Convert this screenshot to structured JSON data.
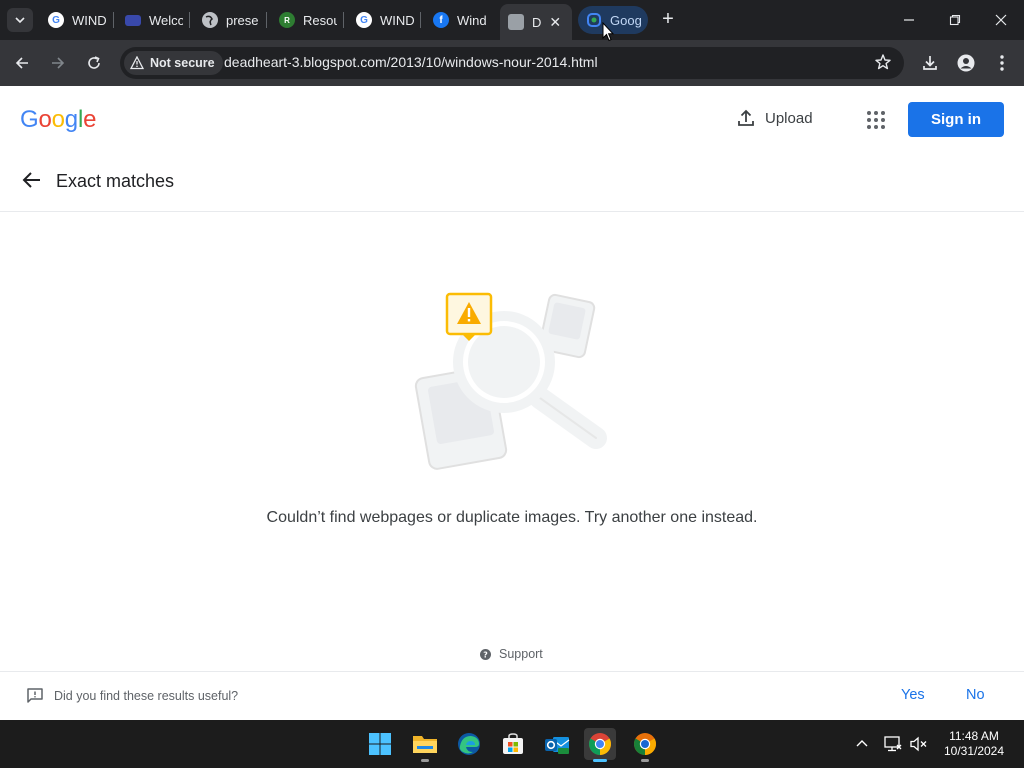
{
  "browser": {
    "tabs": [
      {
        "title": "WIND",
        "favicon": "google-icon"
      },
      {
        "title": "Welco",
        "favicon": "site-icon"
      },
      {
        "title": "prese",
        "favicon": "globe-icon"
      },
      {
        "title": "Resou",
        "favicon": "site-icon"
      },
      {
        "title": "WIND",
        "favicon": "google-icon"
      },
      {
        "title": "Wind",
        "favicon": "facebook-icon"
      },
      {
        "title": "D",
        "favicon": "site-icon",
        "active": true
      },
      {
        "title": "Goog",
        "favicon": "google-lens-icon",
        "hovered": true
      }
    ],
    "security_label": "Not secure",
    "url": "deadheart-3.blogspot.com/2013/10/windows-nour-2014.html"
  },
  "page": {
    "logo": [
      "G",
      "o",
      "o",
      "g",
      "l",
      "e"
    ],
    "upload_label": "Upload",
    "signin_label": "Sign in",
    "section_title": "Exact matches",
    "empty_message": "Couldn’t find webpages or duplicate images. Try another one instead.",
    "support_label": "Support",
    "feedback_question": "Did you find these results useful?",
    "feedback_yes": "Yes",
    "feedback_no": "No"
  },
  "colors": {
    "accent": "#1a73e8",
    "logo": [
      "#4285f4",
      "#ea4335",
      "#fbbc05",
      "#4285f4",
      "#34a853",
      "#ea4335"
    ],
    "warning": "#fbbc04"
  },
  "taskbar": {
    "apps": [
      "windows-start-icon",
      "file-explorer-icon",
      "edge-icon",
      "store-icon",
      "outlook-icon",
      "chrome-icon",
      "chrome-canary-icon"
    ],
    "time": "11:48 AM",
    "date": "10/31/2024"
  }
}
